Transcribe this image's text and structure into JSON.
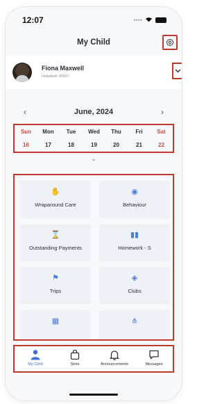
{
  "status": {
    "time": "12:07"
  },
  "header": {
    "title": "My Child"
  },
  "child": {
    "name": "Fiona Maxwell",
    "subtitle": "Helpdesk 40007"
  },
  "calendar": {
    "month_label": "June, 2024",
    "prev": "‹",
    "next": "›",
    "days": [
      {
        "day": "Sun",
        "date": "16",
        "weekend": true
      },
      {
        "day": "Mon",
        "date": "17",
        "weekend": false
      },
      {
        "day": "Tue",
        "date": "18",
        "weekend": false
      },
      {
        "day": "Wed",
        "date": "19",
        "weekend": false
      },
      {
        "day": "Thu",
        "date": "20",
        "weekend": false
      },
      {
        "day": "Fri",
        "date": "21",
        "weekend": false
      },
      {
        "day": "Sat",
        "date": "22",
        "weekend": true
      }
    ],
    "expand": "⌄"
  },
  "tiles": [
    {
      "label": "Wraparound Care",
      "icon": "hand-icon",
      "glyph": "✋"
    },
    {
      "label": "Behaviour",
      "icon": "eye-icon",
      "glyph": "◉"
    },
    {
      "label": "Outstanding Payments",
      "icon": "hourglass-icon",
      "glyph": "⌛"
    },
    {
      "label": "Homework - S",
      "icon": "book-icon",
      "glyph": "▮▮"
    },
    {
      "label": "Trips",
      "icon": "palm-tree-icon",
      "glyph": "⚑"
    },
    {
      "label": "Clubs",
      "icon": "cube-icon",
      "glyph": "◈"
    },
    {
      "label": "",
      "icon": "calendar-icon",
      "glyph": "▦"
    },
    {
      "label": "",
      "icon": "cutlery-icon",
      "glyph": "⋔"
    }
  ],
  "tabs": [
    {
      "label": "My Child",
      "icon": "person-icon",
      "active": true
    },
    {
      "label": "Store",
      "icon": "bag-icon",
      "active": false
    },
    {
      "label": "Announcements",
      "icon": "bell-icon",
      "active": false
    },
    {
      "label": "Messages",
      "icon": "chat-icon",
      "active": false
    }
  ],
  "colors": {
    "accent": "#3b6fd8",
    "weekend": "#d04a3f",
    "highlight": "#c0392b",
    "tile_bg": "#eef1f6"
  }
}
